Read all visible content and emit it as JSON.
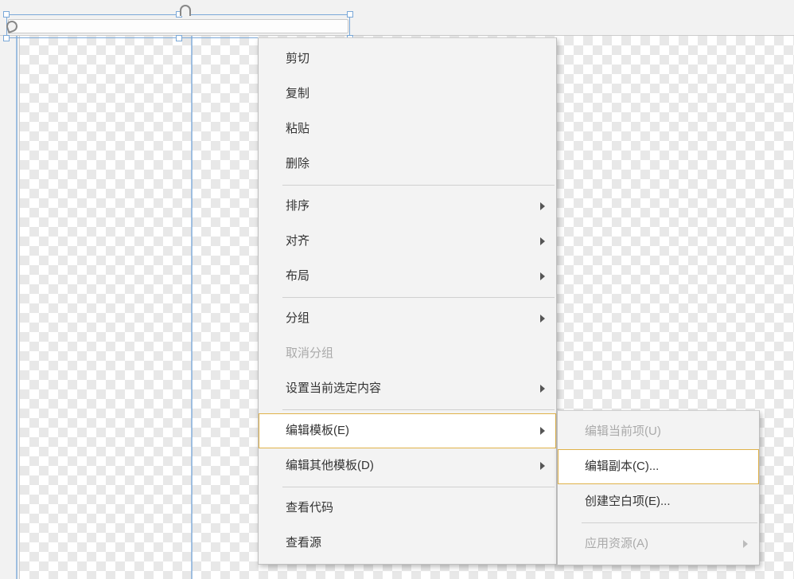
{
  "menu": {
    "cut": "剪切",
    "copy": "复制",
    "paste": "粘贴",
    "delete": "删除",
    "sort": "排序",
    "align": "对齐",
    "layout": "布局",
    "group": "分组",
    "ungroup": "取消分组",
    "set_selection": "设置当前选定内容",
    "edit_template": "编辑模板(E)",
    "edit_other_templates": "编辑其他模板(D)",
    "view_code": "查看代码",
    "view_source": "查看源"
  },
  "submenu": {
    "edit_current": "编辑当前项(U)",
    "edit_copy": "编辑副本(C)...",
    "create_empty": "创建空白项(E)...",
    "apply_resource": "应用资源(A)"
  }
}
